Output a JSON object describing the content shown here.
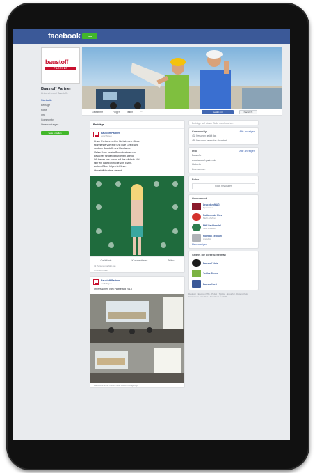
{
  "topbar": {
    "logo": "facebook",
    "badge": "Beta"
  },
  "page": {
    "logo_main": "baustoff",
    "logo_sub": "PARTNER",
    "name": "Baustoff Partner",
    "category": "Unternehmen / Baustoffe"
  },
  "sidebar": {
    "items": [
      {
        "label": "Startseite",
        "active": true
      },
      {
        "label": "Beiträge",
        "active": false
      },
      {
        "label": "Fotos",
        "active": false
      },
      {
        "label": "Info",
        "active": false
      },
      {
        "label": "Community",
        "active": false
      },
      {
        "label": "Veranstaltungen",
        "active": false
      }
    ],
    "create_button": "Seite erstellen"
  },
  "cover_bar": {
    "tabs": [
      "Gefällt mir",
      "Folgen",
      "Teilen",
      "···"
    ],
    "like_button": "Gefällt mir",
    "message_button": "Nachricht"
  },
  "feed": {
    "section_title": "Beiträge",
    "post1": {
      "author": "Baustoff Partner",
      "time": "vor 2 Tagen",
      "text_lines": [
        "Unser Partnerevent im Herbst: viele Gäste,",
        "spannende Vorträge und gute Gespräche",
        "rund um Baustoffe und Handwerk.",
        "Vielen Dank an alle Besucherinnen und",
        "Besucher für den gelungenen Abend!",
        "Wir freuen uns schon auf das nächste Mal.",
        "Hier ein paar Eindrücke vom Event,",
        "weitere Bilder folgen in Kürze.",
        "#baustoff #partner #event"
      ],
      "like": "Gefällt mir",
      "comment": "Kommentieren",
      "share": "Teilen",
      "stats": "32 Personen gefällt das",
      "comments_count": "3 Kommentare"
    },
    "post2": {
      "author": "Baustoff Partner",
      "time": "vor 5 Tagen",
      "text": "Impressionen vom Partnertag 2018",
      "caption": "Baustoff Partner hat 24 neue Fotos hinzugefügt."
    }
  },
  "right": {
    "search_placeholder": "Beiträge auf dieser Seite durchsuchen",
    "community": {
      "title": "Community",
      "link": "Alle anzeigen",
      "lines": [
        "432 Personen gefällt das",
        "455 Personen haben das abonniert"
      ]
    },
    "info": {
      "title": "Info",
      "link": "Alle anzeigen",
      "lines": [
        "Baustoffe",
        "www.baustoff-partner.de",
        "Webseite",
        "Unternehmen"
      ]
    },
    "photos": {
      "title": "Fotos",
      "button": "Fotos hinzufügen"
    },
    "ads1": {
      "title": "Gesponsert",
      "items": [
        {
          "name": "Leuchtkraft AG",
          "sub": "Sponsored",
          "color": "#8b1a2b"
        },
        {
          "name": "Rubbermaid Plus",
          "sub": "Mehr erfahren",
          "color": "#d4322c"
        },
        {
          "name": "FHF Fachhandel",
          "sub": "Jetzt ansehen",
          "color": "#2e7d4f"
        },
        {
          "name": "Holzbau Zentrum",
          "sub": "Angebot",
          "color": "#b0b3b8"
        }
      ],
      "more": "Mehr anzeigen"
    },
    "ads2": {
      "title": "Seiten, die diese Seite mag",
      "items": [
        {
          "name": "Baustoff Netz",
          "color": "#1c1c1c"
        },
        {
          "name": "Zeitlos Bauen",
          "color": "#7cb342"
        },
        {
          "name": "Baustoffwelt",
          "color": "#3b5998"
        }
      ]
    },
    "footer": [
      "Deutsch · English (US) · Polski · Türkçe · Español · Datenschutz",
      "Impressum · Cookies · Facebook © 2018"
    ]
  }
}
